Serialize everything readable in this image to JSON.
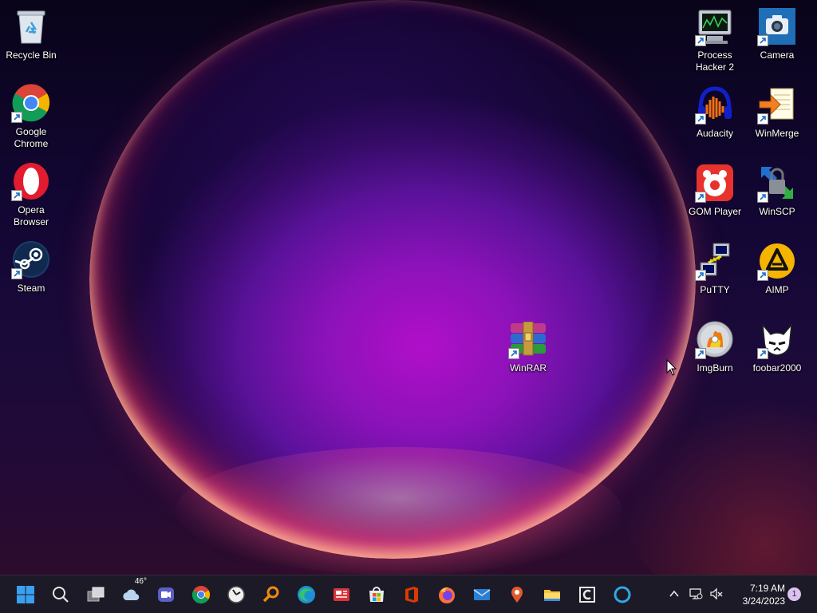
{
  "desktop": {
    "icons_left": [
      {
        "label": "Recycle Bin",
        "icon": "recycle-bin-icon"
      },
      {
        "label": "Google Chrome",
        "icon": "chrome-icon"
      },
      {
        "label": "Opera Browser",
        "icon": "opera-icon"
      },
      {
        "label": "Steam",
        "icon": "steam-icon"
      }
    ],
    "icons_right": [
      {
        "label": "Process Hacker 2",
        "icon": "process-hacker-icon"
      },
      {
        "label": "Camera",
        "icon": "camera-icon"
      },
      {
        "label": "Audacity",
        "icon": "audacity-icon"
      },
      {
        "label": "WinMerge",
        "icon": "winmerge-icon"
      },
      {
        "label": "GOM Player",
        "icon": "gom-player-icon"
      },
      {
        "label": "WinSCP",
        "icon": "winscp-icon"
      },
      {
        "label": "PuTTY",
        "icon": "putty-icon"
      },
      {
        "label": "AIMP",
        "icon": "aimp-icon"
      },
      {
        "label": "ImgBurn",
        "icon": "imgburn-icon"
      },
      {
        "label": "foobar2000",
        "icon": "foobar2000-icon"
      }
    ],
    "icon_center": {
      "label": "WinRAR",
      "icon": "winrar-icon"
    }
  },
  "taskbar": {
    "weather_temp": "46°",
    "pinned": [
      "start-icon",
      "search-icon",
      "task-view-icon",
      "weather-icon",
      "meet-icon",
      "chrome-icon",
      "clock-app-icon",
      "search-app-icon",
      "edge-icon",
      "news-icon",
      "store-icon",
      "office-icon",
      "firefox-icon",
      "maps-icon",
      "mail-icon",
      "file-explorer-icon",
      "ccleaner-icon",
      "cortana-icon"
    ],
    "clock_time": "7:19 AM",
    "clock_date": "3/24/2023",
    "notification_count": "1"
  },
  "colors": {
    "taskbar_bg": "#1c1a26",
    "accent_blue": "#0078d4"
  }
}
